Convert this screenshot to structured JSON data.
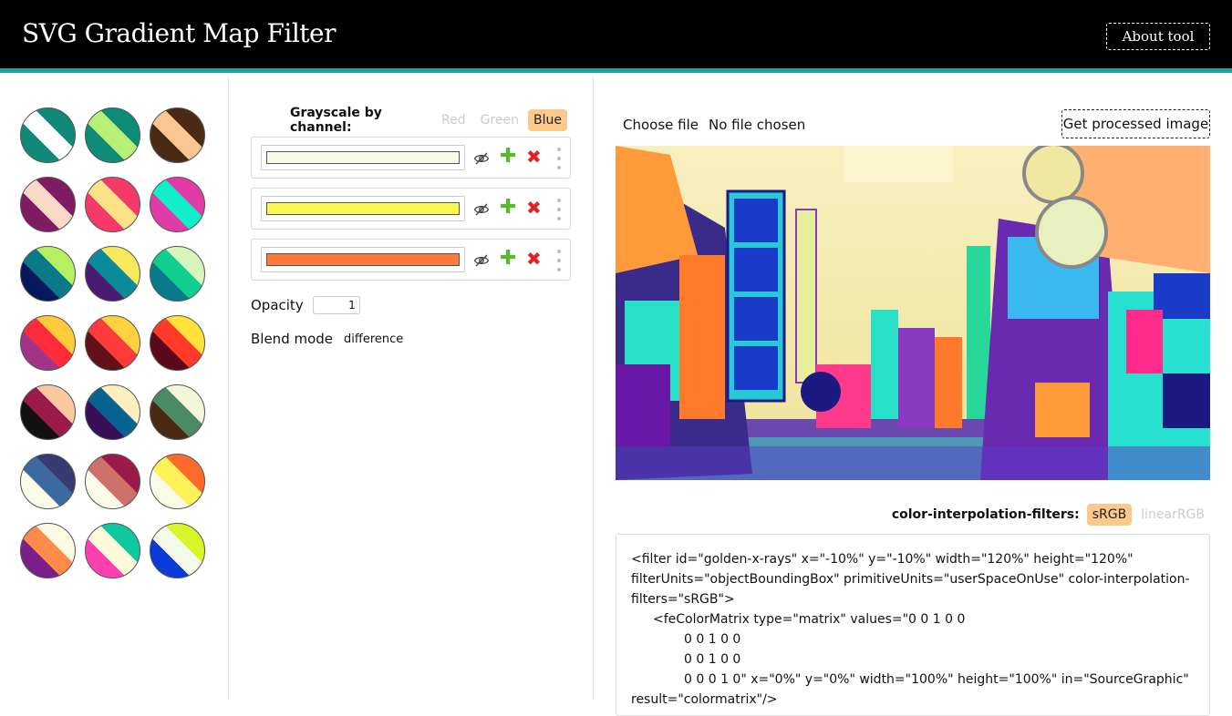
{
  "header": {
    "title": "SVG Gradient Map Filter",
    "about_label": "About tool"
  },
  "palettes": [
    {
      "c1": "#0f8a78",
      "c2": "#ffffff",
      "c3": "#0f8a78"
    },
    {
      "c1": "#0e8c78",
      "c2": "#b8f075",
      "c3": "#0e8c78"
    },
    {
      "c1": "#4b2a16",
      "c2": "#fbc692",
      "c3": "#4b2a16"
    },
    {
      "c1": "#7d1b63",
      "c2": "#fcd9c6",
      "c3": "#7d1b63"
    },
    {
      "c1": "#f53a6a",
      "c2": "#fde287",
      "c3": "#f53a6a"
    },
    {
      "c1": "#e03ca8",
      "c2": "#10f0c8",
      "c3": "#e03ca8"
    },
    {
      "c1": "#06185c",
      "c2": "#0a7a8a",
      "c3": "#b6f060"
    },
    {
      "c1": "#4a1b6e",
      "c2": "#0a8a9a",
      "c3": "#f6e95a"
    },
    {
      "c1": "#0a7a8a",
      "c2": "#0fcf8f",
      "c3": "#d8f5bc"
    },
    {
      "c1": "#a0358a",
      "c2": "#ff2a3a",
      "c3": "#fdca3a"
    },
    {
      "c1": "#62101a",
      "c2": "#ff3a3a",
      "c3": "#ffd140"
    },
    {
      "c1": "#5a0a1a",
      "c2": "#ff3a2a",
      "c3": "#ffe23a"
    },
    {
      "c1": "#111111",
      "c2": "#9a1b4a",
      "c3": "#fbc8a0"
    },
    {
      "c1": "#3a0f5a",
      "c2": "#066390",
      "c3": "#fbeec0"
    },
    {
      "c1": "#4a2a12",
      "c2": "#4b8a62",
      "c3": "#f3f6d8"
    },
    {
      "c1": "#fafae8",
      "c2": "#3a6aa0",
      "c3": "#3a3a72"
    },
    {
      "c1": "#fafae8",
      "c2": "#d0706a",
      "c3": "#9a1b4a"
    },
    {
      "c1": "#fafae8",
      "c2": "#fdf25a",
      "c3": "#ff6a2a"
    },
    {
      "c1": "#7a1e8a",
      "c2": "#ff8a4a",
      "c3": "#fdfae2"
    },
    {
      "c1": "#ff40b0",
      "c2": "#fdfad8",
      "c3": "#10c8a0"
    },
    {
      "c1": "#0a3ad8",
      "c2": "#f3fbe8",
      "c3": "#d8f52a"
    }
  ],
  "panel": {
    "channel_label": "Grayscale by channel:",
    "channels": [
      "Red",
      "Green",
      "Blue"
    ],
    "active_channel": "Blue",
    "stops": [
      {
        "color": "#f7fbe4"
      },
      {
        "color": "#fdf64e"
      },
      {
        "color": "#ff7a3a"
      }
    ],
    "opacity_label": "Opacity",
    "opacity_value": "1",
    "blend_label": "Blend mode",
    "blend_value": "difference"
  },
  "right": {
    "choose_file": "Choose file",
    "no_file": "No file chosen",
    "get_image": "Get processed image",
    "cif_label": "color-interpolation-filters:",
    "cif_options": [
      "sRGB",
      "linearRGB"
    ],
    "cif_active": "sRGB",
    "code_lines": [
      "<filter id=\"golden-x-rays\" x=\"-10%\" y=\"-10%\" width=\"120%\" height=\"120%\"",
      "filterUnits=\"objectBoundingBox\" primitiveUnits=\"userSpaceOnUse\" color-interpolation-",
      "filters=\"sRGB\">",
      "<feColorMatrix type=\"matrix\" values=\"0 0 1 0 0",
      "0 0 1 0 0",
      "0 0 1 0 0",
      "0 0 0 1 0\" x=\"0%\" y=\"0%\" width=\"100%\" height=\"100%\" in=\"SourceGraphic\"",
      "result=\"colormatrix\"/>"
    ]
  }
}
